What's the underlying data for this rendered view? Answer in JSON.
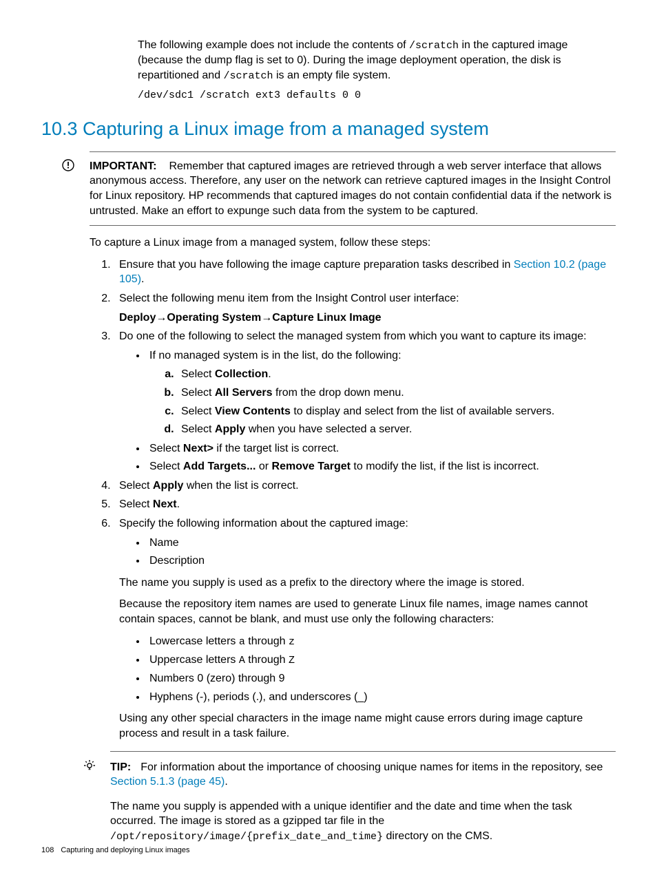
{
  "intro": {
    "p1_a": "The following example does not include the contents of ",
    "p1_code1": "/scratch",
    "p1_b": " in the captured image (because the dump flag is set to 0). During the image deployment operation, the disk is repartitioned and ",
    "p1_code2": "/scratch",
    "p1_c": " is an empty file system.",
    "codeblock": "/dev/sdc1 /scratch ext3 defaults 0 0"
  },
  "heading": "10.3 Capturing a Linux image from a managed system",
  "important": {
    "label": "IMPORTANT:",
    "text": "Remember that captured images are retrieved through a web server interface that allows anonymous access. Therefore, any user on the network can retrieve captured images in the Insight Control for Linux repository. HP recommends that captured images do not contain confidential data if the network is untrusted. Make an effort to expunge such data from the system to be captured."
  },
  "lead": "To capture a Linux image from a managed system, follow these steps:",
  "step1": {
    "a": "Ensure that you have following the image capture preparation tasks described in ",
    "link": "Section 10.2 (page 105)",
    "b": "."
  },
  "step2": {
    "text": "Select the following menu item from the Insight Control user interface:",
    "m1": "Deploy",
    "arrow1": "→",
    "m2": "Operating System",
    "arrow2": "→",
    "m3": "Capture Linux Image"
  },
  "step3": {
    "text": "Do one of the following to select the managed system from which you want to capture its image:",
    "b1": "If no managed system is in the list, do the following:",
    "a_a1": "Select ",
    "a_a2": "Collection",
    "a_a3": ".",
    "a_b1": "Select ",
    "a_b2": "All Servers",
    "a_b3": " from the drop down menu.",
    "a_c1": "Select ",
    "a_c2": "View Contents",
    "a_c3": " to display and select from the list of available servers.",
    "a_d1": "Select ",
    "a_d2": "Apply",
    "a_d3": " when you have selected a server.",
    "b2_a": "Select ",
    "b2_b": "Next>",
    "b2_c": " if the target list is correct.",
    "b3_a": "Select ",
    "b3_b": "Add Targets...",
    "b3_c": " or ",
    "b3_d": "Remove Target",
    "b3_e": " to modify the list, if the list is incorrect."
  },
  "step4": {
    "a": "Select ",
    "b": "Apply",
    "c": " when the list is correct."
  },
  "step5": {
    "a": "Select ",
    "b": "Next",
    "c": "."
  },
  "step6": {
    "text": "Specify the following information about the captured image:",
    "b1": "Name",
    "b2": "Description",
    "p1": "The name you supply is used as a prefix to the directory where the image is stored.",
    "p2": "Because the repository item names are used to generate Linux file names, image names cannot contain spaces, cannot be blank, and must use only the following characters:",
    "c1a": "Lowercase letters ",
    "c1b": "a",
    "c1c": " through ",
    "c1d": "z",
    "c2a": "Uppercase letters ",
    "c2b": "A",
    "c2c": " through ",
    "c2d": "Z",
    "c3": "Numbers 0 (zero) through 9",
    "c4": "Hyphens (-), periods (.), and underscores (_)",
    "p3": "Using any other special characters in the image name might cause errors during image capture process and result in a task failure."
  },
  "tip": {
    "label": "TIP:",
    "a": "For information about the importance of choosing unique names for items in the repository, see ",
    "link": "Section 5.1.3 (page 45)",
    "b": "."
  },
  "after": {
    "a": "The name you supply is appended with a unique identifier and the date and time when the task occurred. The image is stored as a gzipped tar file in the ",
    "code1": "/opt/repository/image/{prefix_date_and_time}",
    "b": " directory on the CMS."
  },
  "footer": {
    "page": "108",
    "chapter": "Capturing and deploying Linux images"
  }
}
